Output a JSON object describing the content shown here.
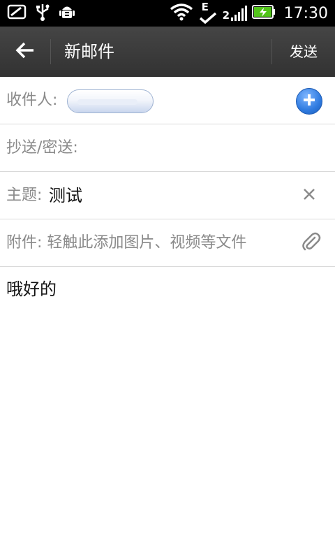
{
  "status_bar": {
    "time": "17:30",
    "network_type": "E",
    "network_sim": "2",
    "icons": [
      "image-icon",
      "usb-icon",
      "android-debug-icon",
      "wifi-icon",
      "signal-icon",
      "battery-charging-icon"
    ]
  },
  "app_bar": {
    "title": "新邮件",
    "send_label": "发送",
    "back_icon": "arrow-left-icon"
  },
  "form": {
    "to_label": "收件人:",
    "cc_bcc_label": "抄送/密送:",
    "subject_label": "主题:",
    "subject_value": "测试",
    "attachment_label": "附件: 轻触此添加图片、视频等文件"
  },
  "body": {
    "text": "哦好的"
  },
  "colors": {
    "app_bar": "#3c3c3c",
    "label": "#8a8a8a",
    "accent_blue": "#2f7be0",
    "battery_green": "#52c41a"
  }
}
